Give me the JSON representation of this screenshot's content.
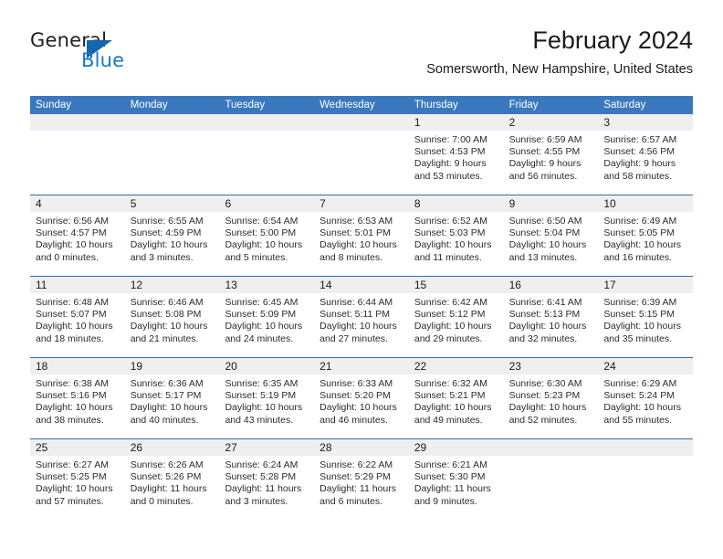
{
  "brand": {
    "name_part1": "General",
    "name_part2": "Blue",
    "triangle_color": "#1566b0",
    "blue_text_color": "#1b77c4"
  },
  "header": {
    "title": "February 2024",
    "subtitle": "Somersworth, New Hampshire, United States"
  },
  "theme": {
    "header_bar_color": "#3a78be",
    "week_divider_color": "#2f6fae",
    "day_band_color": "#efefef"
  },
  "weekdays": [
    "Sunday",
    "Monday",
    "Tuesday",
    "Wednesday",
    "Thursday",
    "Friday",
    "Saturday"
  ],
  "weeks": [
    [
      {
        "day": "",
        "sunrise": "",
        "sunset": "",
        "daylight": "",
        "daylight2": ""
      },
      {
        "day": "",
        "sunrise": "",
        "sunset": "",
        "daylight": "",
        "daylight2": ""
      },
      {
        "day": "",
        "sunrise": "",
        "sunset": "",
        "daylight": "",
        "daylight2": ""
      },
      {
        "day": "",
        "sunrise": "",
        "sunset": "",
        "daylight": "",
        "daylight2": ""
      },
      {
        "day": "1",
        "sunrise": "Sunrise: 7:00 AM",
        "sunset": "Sunset: 4:53 PM",
        "daylight": "Daylight: 9 hours",
        "daylight2": "and 53 minutes."
      },
      {
        "day": "2",
        "sunrise": "Sunrise: 6:59 AM",
        "sunset": "Sunset: 4:55 PM",
        "daylight": "Daylight: 9 hours",
        "daylight2": "and 56 minutes."
      },
      {
        "day": "3",
        "sunrise": "Sunrise: 6:57 AM",
        "sunset": "Sunset: 4:56 PM",
        "daylight": "Daylight: 9 hours",
        "daylight2": "and 58 minutes."
      }
    ],
    [
      {
        "day": "4",
        "sunrise": "Sunrise: 6:56 AM",
        "sunset": "Sunset: 4:57 PM",
        "daylight": "Daylight: 10 hours",
        "daylight2": "and 0 minutes."
      },
      {
        "day": "5",
        "sunrise": "Sunrise: 6:55 AM",
        "sunset": "Sunset: 4:59 PM",
        "daylight": "Daylight: 10 hours",
        "daylight2": "and 3 minutes."
      },
      {
        "day": "6",
        "sunrise": "Sunrise: 6:54 AM",
        "sunset": "Sunset: 5:00 PM",
        "daylight": "Daylight: 10 hours",
        "daylight2": "and 5 minutes."
      },
      {
        "day": "7",
        "sunrise": "Sunrise: 6:53 AM",
        "sunset": "Sunset: 5:01 PM",
        "daylight": "Daylight: 10 hours",
        "daylight2": "and 8 minutes."
      },
      {
        "day": "8",
        "sunrise": "Sunrise: 6:52 AM",
        "sunset": "Sunset: 5:03 PM",
        "daylight": "Daylight: 10 hours",
        "daylight2": "and 11 minutes."
      },
      {
        "day": "9",
        "sunrise": "Sunrise: 6:50 AM",
        "sunset": "Sunset: 5:04 PM",
        "daylight": "Daylight: 10 hours",
        "daylight2": "and 13 minutes."
      },
      {
        "day": "10",
        "sunrise": "Sunrise: 6:49 AM",
        "sunset": "Sunset: 5:05 PM",
        "daylight": "Daylight: 10 hours",
        "daylight2": "and 16 minutes."
      }
    ],
    [
      {
        "day": "11",
        "sunrise": "Sunrise: 6:48 AM",
        "sunset": "Sunset: 5:07 PM",
        "daylight": "Daylight: 10 hours",
        "daylight2": "and 18 minutes."
      },
      {
        "day": "12",
        "sunrise": "Sunrise: 6:46 AM",
        "sunset": "Sunset: 5:08 PM",
        "daylight": "Daylight: 10 hours",
        "daylight2": "and 21 minutes."
      },
      {
        "day": "13",
        "sunrise": "Sunrise: 6:45 AM",
        "sunset": "Sunset: 5:09 PM",
        "daylight": "Daylight: 10 hours",
        "daylight2": "and 24 minutes."
      },
      {
        "day": "14",
        "sunrise": "Sunrise: 6:44 AM",
        "sunset": "Sunset: 5:11 PM",
        "daylight": "Daylight: 10 hours",
        "daylight2": "and 27 minutes."
      },
      {
        "day": "15",
        "sunrise": "Sunrise: 6:42 AM",
        "sunset": "Sunset: 5:12 PM",
        "daylight": "Daylight: 10 hours",
        "daylight2": "and 29 minutes."
      },
      {
        "day": "16",
        "sunrise": "Sunrise: 6:41 AM",
        "sunset": "Sunset: 5:13 PM",
        "daylight": "Daylight: 10 hours",
        "daylight2": "and 32 minutes."
      },
      {
        "day": "17",
        "sunrise": "Sunrise: 6:39 AM",
        "sunset": "Sunset: 5:15 PM",
        "daylight": "Daylight: 10 hours",
        "daylight2": "and 35 minutes."
      }
    ],
    [
      {
        "day": "18",
        "sunrise": "Sunrise: 6:38 AM",
        "sunset": "Sunset: 5:16 PM",
        "daylight": "Daylight: 10 hours",
        "daylight2": "and 38 minutes."
      },
      {
        "day": "19",
        "sunrise": "Sunrise: 6:36 AM",
        "sunset": "Sunset: 5:17 PM",
        "daylight": "Daylight: 10 hours",
        "daylight2": "and 40 minutes."
      },
      {
        "day": "20",
        "sunrise": "Sunrise: 6:35 AM",
        "sunset": "Sunset: 5:19 PM",
        "daylight": "Daylight: 10 hours",
        "daylight2": "and 43 minutes."
      },
      {
        "day": "21",
        "sunrise": "Sunrise: 6:33 AM",
        "sunset": "Sunset: 5:20 PM",
        "daylight": "Daylight: 10 hours",
        "daylight2": "and 46 minutes."
      },
      {
        "day": "22",
        "sunrise": "Sunrise: 6:32 AM",
        "sunset": "Sunset: 5:21 PM",
        "daylight": "Daylight: 10 hours",
        "daylight2": "and 49 minutes."
      },
      {
        "day": "23",
        "sunrise": "Sunrise: 6:30 AM",
        "sunset": "Sunset: 5:23 PM",
        "daylight": "Daylight: 10 hours",
        "daylight2": "and 52 minutes."
      },
      {
        "day": "24",
        "sunrise": "Sunrise: 6:29 AM",
        "sunset": "Sunset: 5:24 PM",
        "daylight": "Daylight: 10 hours",
        "daylight2": "and 55 minutes."
      }
    ],
    [
      {
        "day": "25",
        "sunrise": "Sunrise: 6:27 AM",
        "sunset": "Sunset: 5:25 PM",
        "daylight": "Daylight: 10 hours",
        "daylight2": "and 57 minutes."
      },
      {
        "day": "26",
        "sunrise": "Sunrise: 6:26 AM",
        "sunset": "Sunset: 5:26 PM",
        "daylight": "Daylight: 11 hours",
        "daylight2": "and 0 minutes."
      },
      {
        "day": "27",
        "sunrise": "Sunrise: 6:24 AM",
        "sunset": "Sunset: 5:28 PM",
        "daylight": "Daylight: 11 hours",
        "daylight2": "and 3 minutes."
      },
      {
        "day": "28",
        "sunrise": "Sunrise: 6:22 AM",
        "sunset": "Sunset: 5:29 PM",
        "daylight": "Daylight: 11 hours",
        "daylight2": "and 6 minutes."
      },
      {
        "day": "29",
        "sunrise": "Sunrise: 6:21 AM",
        "sunset": "Sunset: 5:30 PM",
        "daylight": "Daylight: 11 hours",
        "daylight2": "and 9 minutes."
      },
      {
        "day": "",
        "sunrise": "",
        "sunset": "",
        "daylight": "",
        "daylight2": ""
      },
      {
        "day": "",
        "sunrise": "",
        "sunset": "",
        "daylight": "",
        "daylight2": ""
      }
    ]
  ]
}
